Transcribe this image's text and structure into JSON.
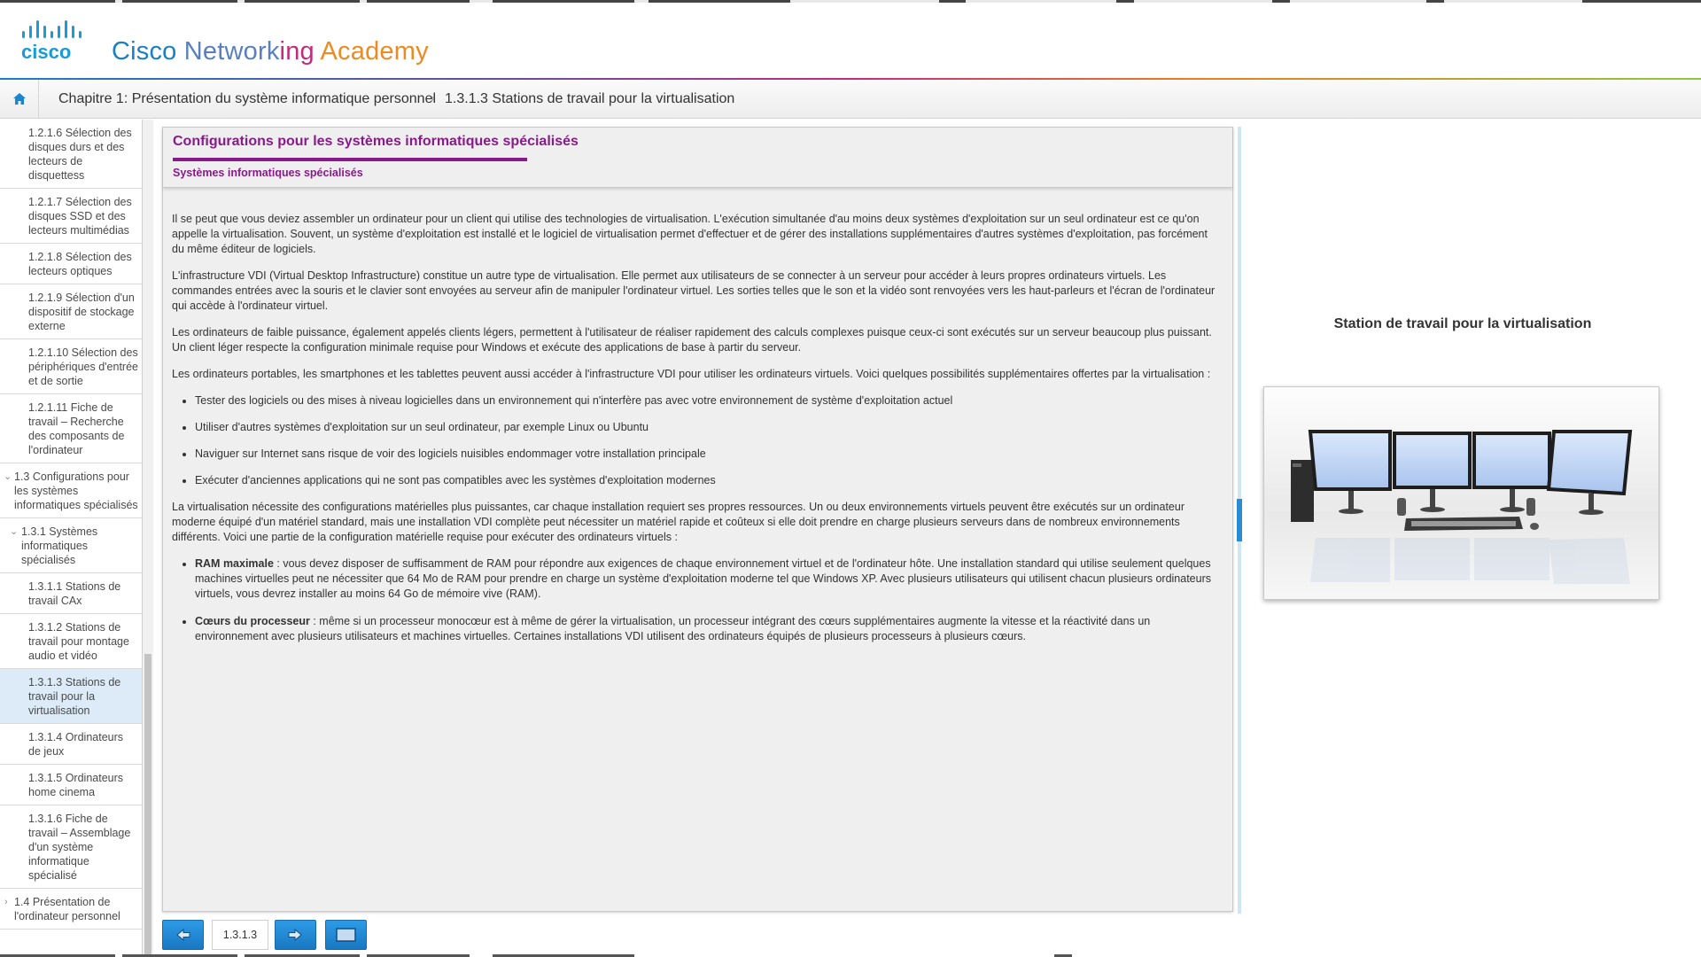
{
  "brand": {
    "logo_text": "cisco",
    "name_parts": [
      {
        "text": "Cisco ",
        "color": "#1a7fc4"
      },
      {
        "text": "Network",
        "color": "#5a7fbf"
      },
      {
        "text": "ing ",
        "color": "#c42b7a"
      },
      {
        "text": "Academy",
        "color": "#ee8a22"
      }
    ]
  },
  "breadcrumb": {
    "home_icon": "home-icon",
    "chapter": "Chapitre 1: Présentation du système informatique personnel",
    "separator": "›",
    "current": "1.3.1.3 Stations de travail pour la virtualisation"
  },
  "sidebar": {
    "items": [
      {
        "label": "1.2.1.6 Sélection des disques durs et des lecteurs de disquettess"
      },
      {
        "label": "1.2.1.7 Sélection des disques SSD et des lecteurs multimédias"
      },
      {
        "label": "1.2.1.8 Sélection des lecteurs optiques"
      },
      {
        "label": "1.2.1.9 Sélection d'un dispositif de stockage externe"
      },
      {
        "label": "1.2.1.10 Sélection des périphériques d'entrée et de sortie"
      },
      {
        "label": "1.2.1.11 Fiche de travail – Recherche des composants de l'ordinateur"
      },
      {
        "label": "1.3 Configurations pour les systèmes informatiques spécialisés"
      },
      {
        "label": "1.3.1 Systèmes informatiques spécialisés"
      },
      {
        "label": "1.3.1.1 Stations de travail CAx"
      },
      {
        "label": "1.3.1.2 Stations de travail pour montage audio et vidéo"
      },
      {
        "label": "1.3.1.3 Stations de travail pour la virtualisation"
      },
      {
        "label": "1.3.1.4 Ordinateurs de jeux"
      },
      {
        "label": "1.3.1.5 Ordinateurs home cinema"
      },
      {
        "label": "1.3.1.6 Fiche de travail – Assemblage d'un système informatique spécialisé"
      },
      {
        "label": "1.4 Présentation de l'ordinateur personnel"
      }
    ]
  },
  "panel": {
    "title": "Configurations pour les systèmes informatiques spécialisés",
    "subtitle": "Systèmes informatiques spécialisés",
    "p1": "Il se peut que vous deviez assembler un ordinateur pour un client qui utilise des technologies de virtualisation. L'exécution simultanée d'au moins deux systèmes d'exploitation sur un seul ordinateur est ce qu'on appelle la virtualisation. Souvent, un système d'exploitation est installé et le logiciel de virtualisation permet d'effectuer et de gérer des installations supplémentaires d'autres systèmes d'exploitation, pas forcément du même éditeur de logiciels.",
    "p2": "L'infrastructure VDI (Virtual Desktop Infrastructure) constitue un autre type de virtualisation. Elle permet aux utilisateurs de se connecter à un serveur pour accéder à leurs propres ordinateurs virtuels. Les commandes entrées avec la souris et le clavier sont envoyées au serveur afin de manipuler l'ordinateur virtuel. Les sorties telles que le son et la vidéo sont renvoyées vers les haut-parleurs et l'écran de l'ordinateur qui accède à l'ordinateur virtuel.",
    "p3": "Les ordinateurs de faible puissance, également appelés clients légers, permettent à l'utilisateur de réaliser rapidement des calculs complexes puisque ceux-ci sont exécutés sur un serveur beaucoup plus puissant. Un client léger respecte la configuration minimale requise pour Windows et exécute des applications de base à partir du serveur.",
    "p4": "Les ordinateurs portables, les smartphones et les tablettes peuvent aussi accéder à l'infrastructure VDI pour utiliser les ordinateurs virtuels. Voici quelques possibilités supplémentaires offertes par la virtualisation :",
    "bullets1": [
      "Tester des logiciels ou des mises à niveau logicielles dans un environnement qui n'interfère pas avec votre environnement de système d'exploitation actuel",
      "Utiliser d'autres systèmes d'exploitation sur un seul ordinateur, par exemple Linux ou Ubuntu",
      "Naviguer sur Internet sans risque de voir des logiciels nuisibles endommager votre installation principale",
      "Exécuter d'anciennes applications qui ne sont pas compatibles avec les systèmes d'exploitation modernes"
    ],
    "p5": "La virtualisation nécessite des configurations matérielles plus puissantes, car chaque installation requiert ses propres ressources. Un ou deux environnements virtuels peuvent être exécutés sur un ordinateur moderne équipé d'un matériel standard, mais une installation VDI complète peut nécessiter un matériel rapide et coûteux si elle doit prendre en charge plusieurs serveurs dans de nombreux environnements différents. Voici une partie de la configuration matérielle requise pour exécuter des ordinateurs virtuels :",
    "bullets2": [
      {
        "term": "RAM maximale",
        "text": " : vous devez disposer de suffisamment de RAM pour répondre aux exigences de chaque environnement virtuel et de l'ordinateur hôte. Une installation standard qui utilise seulement quelques machines virtuelles peut ne nécessiter que 64 Mo de RAM pour prendre en charge un système d'exploitation moderne tel que Windows XP. Avec plusieurs utilisateurs qui utilisent chacun plusieurs ordinateurs virtuels, vous devrez installer au moins 64 Go de mémoire vive (RAM)."
      },
      {
        "term": "Cœurs du processeur",
        "text": " : même si un processeur monocœur est à même de gérer la virtualisation, un processeur intégrant des cœurs supplémentaires augmente la vitesse et la réactivité dans un environnement avec plusieurs utilisateurs et machines virtuelles. Certaines installations VDI utilisent des ordinateurs équipés de plusieurs processeurs à plusieurs cœurs."
      }
    ]
  },
  "figure": {
    "caption": "Station de travail pour la virtualisation"
  },
  "nav": {
    "page": "1.3.1.3",
    "prev_icon": "arrow-left-icon",
    "next_icon": "arrow-right-icon",
    "media_icon": "screen-icon"
  },
  "colors": {
    "accent_purple": "#8a1a8c",
    "button_blue": "#1f86d0",
    "active_item": "#dcebf7"
  }
}
